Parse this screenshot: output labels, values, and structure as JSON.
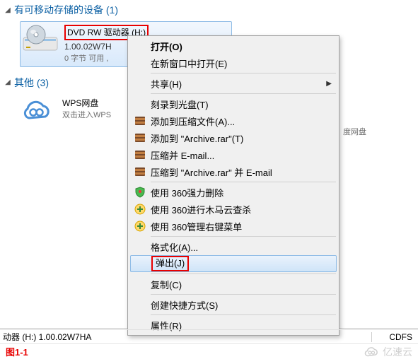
{
  "sections": {
    "removable": {
      "title": "有可移动存储的设备 (1)"
    },
    "other": {
      "title": "其他 (3)"
    }
  },
  "dvd": {
    "title": "DVD RW 驱动器 (H:)",
    "line2": "1.00.02W7H",
    "line3": "0 字节 可用 ,"
  },
  "wps": {
    "title": "WPS网盘",
    "sub": "双击进入WPS",
    "trailing": "度网盘"
  },
  "menu": {
    "open": "打开(O)",
    "new_window": "在新窗口中打开(E)",
    "share": "共享(H)",
    "burn": "刻录到光盘(T)",
    "add_archive": "添加到压缩文件(A)...",
    "add_archive_rar": "添加到 \"Archive.rar\"(T)",
    "compress_email": "压缩并 E-mail...",
    "compress_rar_email": "压缩到 \"Archive.rar\" 并 E-mail",
    "use_360_delete": "使用 360强力删除",
    "use_360_trojan": "使用 360进行木马云查杀",
    "use_360_rmenu": "使用 360管理右键菜单",
    "format": "格式化(A)...",
    "eject": "弹出(J)",
    "copy": "复制(C)",
    "shortcut": "创建快捷方式(S)",
    "properties": "属性(R)"
  },
  "status": {
    "left": "动器 (H:) 1.00.02W7HA",
    "right": "CDFS"
  },
  "caption": "图1-1",
  "watermark": "亿速云",
  "icons": {
    "rar": "rar",
    "shield_red": "●",
    "shield_green": "+",
    "cloud_ring": "∞"
  }
}
